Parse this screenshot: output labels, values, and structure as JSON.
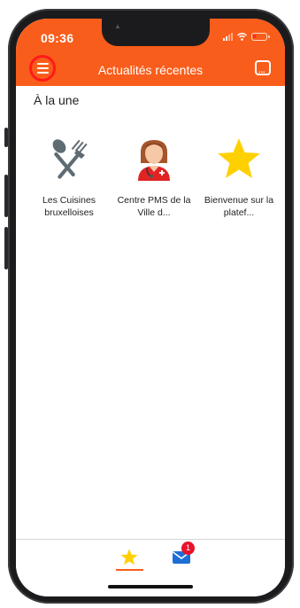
{
  "status_bar": {
    "time": "09:36"
  },
  "header": {
    "title": "Actualités récentes",
    "menu_icon": "hamburger-menu-icon",
    "chat_icon": "chat-bubble-icon",
    "background_color": "#f95d1b"
  },
  "section": {
    "title": "À la une"
  },
  "tiles": [
    {
      "label": "Les Cuisines bruxelloises",
      "icon": "fork-spoon-icon"
    },
    {
      "label": "Centre PMS de la Ville d...",
      "icon": "nurse-avatar-icon"
    },
    {
      "label": "Bienvenue sur la platef...",
      "icon": "star-icon"
    }
  ],
  "tabbar": {
    "favorites_icon": "star-icon",
    "messages_icon": "envelope-icon",
    "messages_badge": "1",
    "active_color": "#f95d1b"
  }
}
